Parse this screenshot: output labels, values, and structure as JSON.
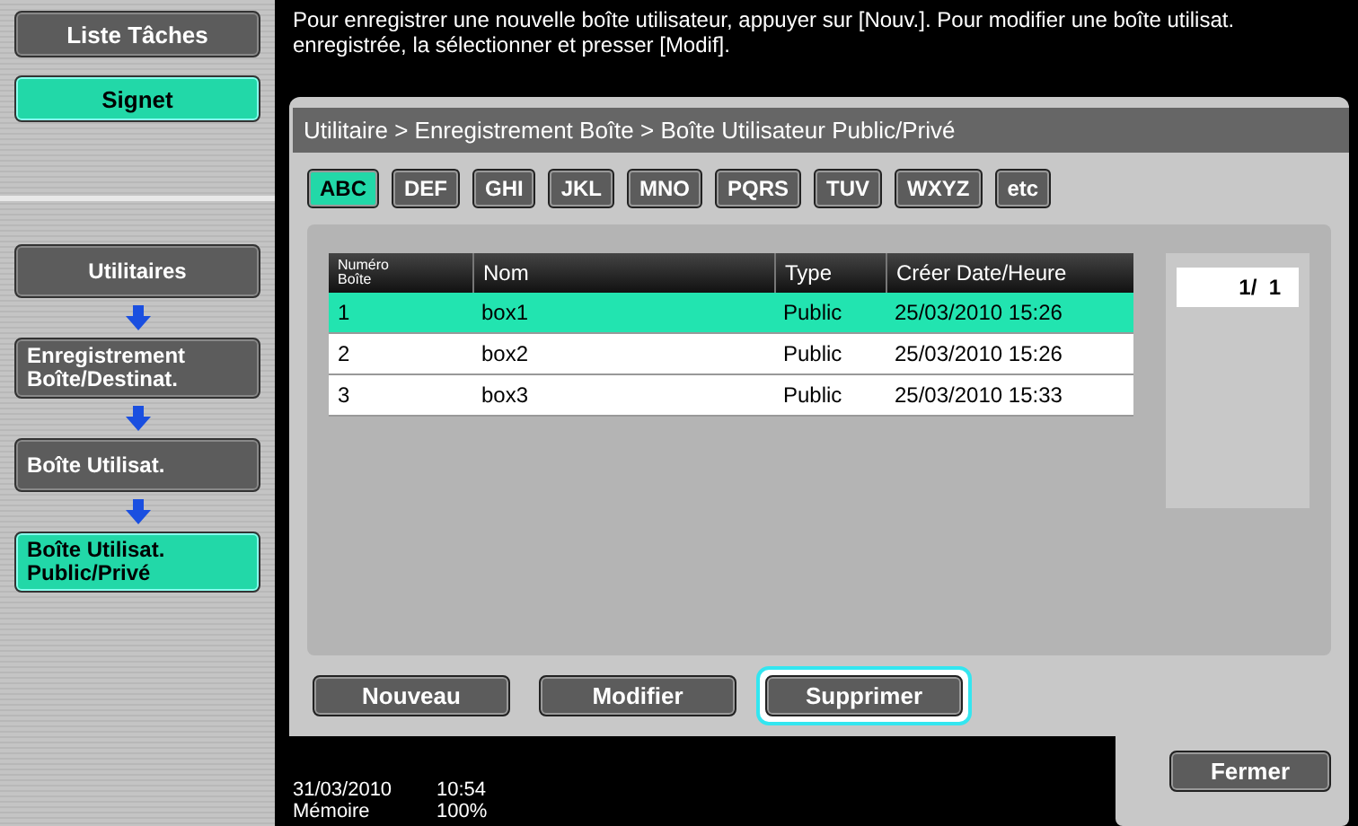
{
  "sidebar": {
    "top_buttons": [
      {
        "label": "Liste Tâches",
        "selected": false
      },
      {
        "label": "Signet",
        "selected": true
      }
    ],
    "path": [
      {
        "label": "Utilitaires",
        "current": false
      },
      {
        "label": "Enregistrement\nBoîte/Destinat.",
        "current": false
      },
      {
        "label": "Boîte Utilisat.",
        "current": false
      },
      {
        "label": "Boîte Utilisat.\nPublic/Privé",
        "current": true
      }
    ]
  },
  "message": "Pour enregistrer une nouvelle boîte utilisateur, appuyer sur [Nouv.]. Pour modifier une boîte utilisat. enregistrée, la sélectionner et presser [Modif].",
  "breadcrumb": "Utilitaire > Enregistrement Boîte > Boîte Utilisateur Public/Privé",
  "index_tabs": [
    {
      "label": "ABC",
      "selected": true
    },
    {
      "label": "DEF",
      "selected": false
    },
    {
      "label": "GHI",
      "selected": false
    },
    {
      "label": "JKL",
      "selected": false
    },
    {
      "label": "MNO",
      "selected": false
    },
    {
      "label": "PQRS",
      "selected": false
    },
    {
      "label": "TUV",
      "selected": false
    },
    {
      "label": "WXYZ",
      "selected": false
    },
    {
      "label": "etc",
      "selected": false
    }
  ],
  "table": {
    "columns": [
      "Numéro\nBoîte",
      "Nom",
      "Type",
      "Créer Date/Heure"
    ],
    "rows": [
      {
        "cells": [
          "1",
          "box1",
          "Public",
          "25/03/2010 15:26"
        ],
        "selected": true
      },
      {
        "cells": [
          "2",
          "box2",
          "Public",
          "25/03/2010 15:26"
        ],
        "selected": false
      },
      {
        "cells": [
          "3",
          "box3",
          "Public",
          "25/03/2010 15:33"
        ],
        "selected": false
      }
    ]
  },
  "page_counter": "1/  1",
  "actions": [
    {
      "label": "Nouveau",
      "highlighted": false
    },
    {
      "label": "Modifier",
      "highlighted": false
    },
    {
      "label": "Supprimer",
      "highlighted": true
    }
  ],
  "status": {
    "date": "31/03/2010",
    "time": "10:54",
    "memory_label": "Mémoire",
    "memory_value": "100%"
  },
  "close_button": "Fermer"
}
